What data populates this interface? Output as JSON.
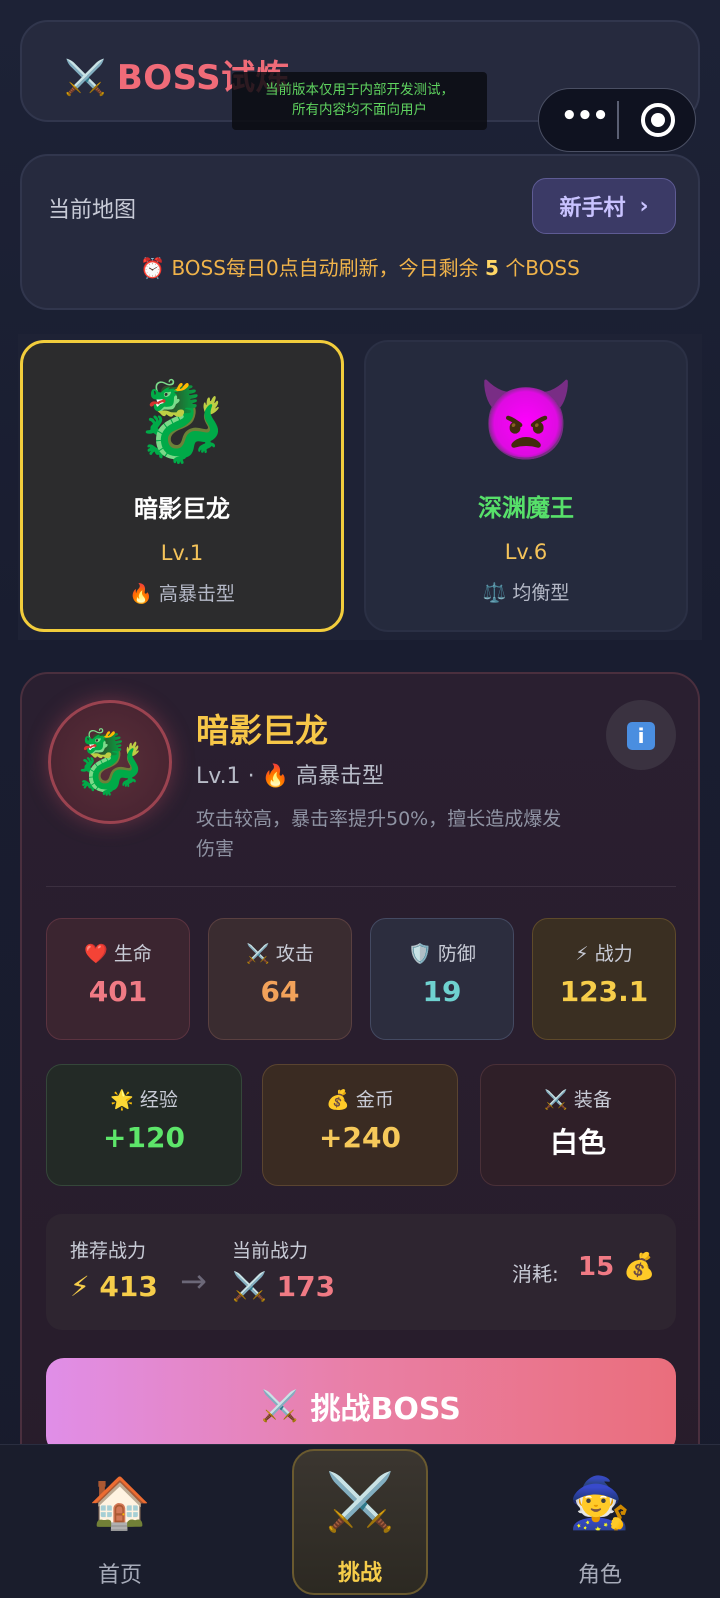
{
  "header": {
    "title": "BOSS试炼",
    "title_icon": "crossed-swords-icon"
  },
  "notice": {
    "line1": "当前版本仅用于内部开发测试，",
    "line2": "所有内容均不面向用户"
  },
  "capsule": {
    "more_icon": "more-dots-icon",
    "close_icon": "target-icon"
  },
  "map": {
    "label": "当前地图",
    "current": "新手村",
    "chevron": "›",
    "refresh_prefix": "BOSS每日0点自动刷新，今日剩余",
    "refresh_count": "5",
    "refresh_suffix": "个BOSS"
  },
  "bosses": [
    {
      "name": "暗影巨龙",
      "level": "Lv.1",
      "type": "高暴击型",
      "avatar": "🐉",
      "type_icon": "🔥",
      "selected": true
    },
    {
      "name": "深渊魔王",
      "level": "Lv.6",
      "type": "均衡型",
      "avatar": "👿",
      "type_icon": "⚖️",
      "selected": false
    }
  ],
  "detail": {
    "name": "暗影巨龙",
    "avatar": "🐉",
    "meta_level": "Lv.1",
    "meta_sep": "·",
    "meta_type_icon": "🔥",
    "meta_type": "高暴击型",
    "description": "攻击较高，暴击率提升50%，擅长造成爆发伤害",
    "info_icon": "i"
  },
  "stats": {
    "hp": {
      "icon": "❤️",
      "label": "生命",
      "value": "401"
    },
    "atk": {
      "icon": "⚔️",
      "label": "攻击",
      "value": "64"
    },
    "def": {
      "icon": "🛡️",
      "label": "防御",
      "value": "19"
    },
    "power": {
      "icon": "⚡",
      "label": "战力",
      "value": "123.1"
    }
  },
  "rewards": {
    "exp": {
      "icon": "🌟",
      "label": "经验",
      "value": "+120"
    },
    "gold": {
      "icon": "💰",
      "label": "金币",
      "value": "+240"
    },
    "equip": {
      "icon": "⚔️",
      "label": "装备",
      "value": "白色"
    }
  },
  "power_compare": {
    "recommended_label": "推荐战力",
    "recommended_icon": "⚡",
    "recommended_value": "413",
    "arrow": "→",
    "current_label": "当前战力",
    "current_icon": "⚔️",
    "current_value": "173",
    "cost_label": "消耗:",
    "cost_value": "15",
    "cost_icon": "💰"
  },
  "challenge_button": {
    "icon": "⚔️",
    "label": "挑战BOSS"
  },
  "nav": [
    {
      "label": "首页",
      "icon": "🏠"
    },
    {
      "label": "挑战",
      "icon": "⚔️"
    },
    {
      "label": "角色",
      "icon": "🧙"
    }
  ],
  "colors": {
    "accent_gold": "#f6cd4a",
    "accent_red": "#f07a84",
    "selected_border": "#f2cd3c",
    "button_gradient_start": "#e08ee8",
    "button_gradient_end": "#ea6e7c"
  }
}
